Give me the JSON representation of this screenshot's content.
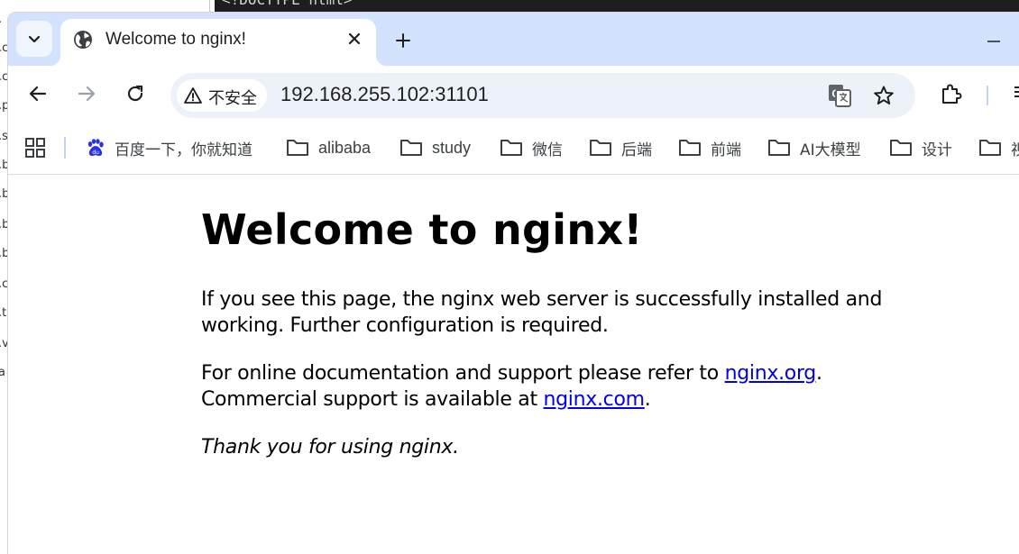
{
  "background_editor": {
    "top_text": "<!DOCTYPE html>",
    "gutter_chars": [
      ".",
      ".c",
      ".c",
      ".p",
      ".s",
      ".b",
      ".b",
      ".b",
      ".b",
      ".c",
      ".t",
      ".v",
      "a"
    ]
  },
  "tab": {
    "title": "Welcome to nginx!",
    "favicon": "globe-icon"
  },
  "toolbar": {
    "security_label": "不安全",
    "url": "192.168.255.102:31101"
  },
  "bookmarks": {
    "items": [
      {
        "label": "百度一下，你就知道",
        "icon": "baidu-icon"
      },
      {
        "label": "alibaba",
        "icon": "folder-icon"
      },
      {
        "label": "study",
        "icon": "folder-icon"
      },
      {
        "label": "微信",
        "icon": "folder-icon"
      },
      {
        "label": "后端",
        "icon": "folder-icon"
      },
      {
        "label": "前端",
        "icon": "folder-icon"
      },
      {
        "label": "AI大模型",
        "icon": "folder-icon"
      },
      {
        "label": "设计",
        "icon": "folder-icon"
      },
      {
        "label": "视",
        "icon": "folder-icon"
      }
    ]
  },
  "page": {
    "heading": "Welcome to nginx!",
    "p1": "If you see this page, the nginx web server is successfully installed and working. Further configuration is required.",
    "p2_before": "For online documentation and support please refer to ",
    "p2_link1": "nginx.org",
    "p2_mid": ".",
    "p2_line2": "Commercial support is available at ",
    "p2_link2": "nginx.com",
    "p2_end": ".",
    "p3": "Thank you for using nginx."
  },
  "colors": {
    "tabstrip": "#d3e3fd",
    "omnibox": "#edf2fa",
    "link": "#0000ee"
  }
}
